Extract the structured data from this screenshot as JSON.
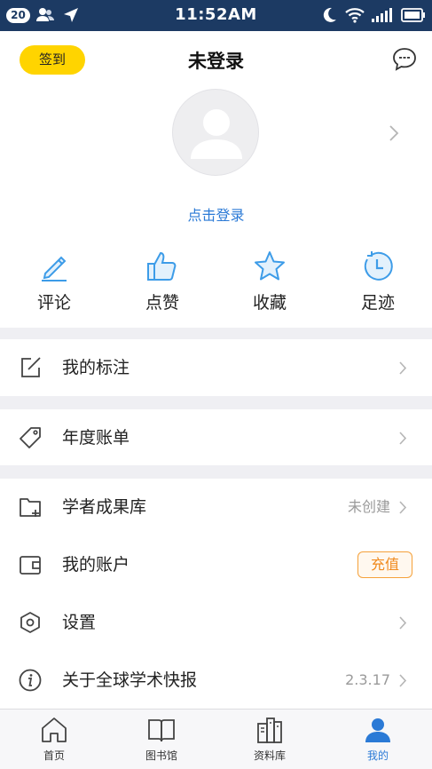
{
  "status_bar": {
    "badge": "20",
    "time": "11:52AM"
  },
  "header": {
    "checkin_label": "签到",
    "title": "未登录"
  },
  "profile": {
    "login_link": "点击登录"
  },
  "quick_actions": [
    {
      "label": "评论",
      "icon": "pencil-icon"
    },
    {
      "label": "点赞",
      "icon": "thumbs-up-icon"
    },
    {
      "label": "收藏",
      "icon": "star-icon"
    },
    {
      "label": "足迹",
      "icon": "history-clock-icon"
    }
  ],
  "menu": {
    "annotations": {
      "label": "我的标注",
      "icon": "edit-square-icon"
    },
    "annual_bill": {
      "label": "年度账单",
      "icon": "tag-icon"
    },
    "scholar_repo": {
      "label": "学者成果库",
      "value": "未创建",
      "icon": "folder-plus-icon"
    },
    "account": {
      "label": "我的账户",
      "action": "充值",
      "icon": "wallet-icon"
    },
    "settings": {
      "label": "设置",
      "icon": "hexagon-gear-icon"
    },
    "about": {
      "label": "关于全球学术快报",
      "value": "2.3.17",
      "icon": "info-icon"
    }
  },
  "tabs": [
    {
      "label": "首页",
      "icon": "home-icon"
    },
    {
      "label": "图书馆",
      "icon": "book-icon"
    },
    {
      "label": "资料库",
      "icon": "database-shelf-icon"
    },
    {
      "label": "我的",
      "icon": "person-icon",
      "active": true
    }
  ],
  "colors": {
    "status_bar": "#1c3a63",
    "accent_blue": "#2b7ad6",
    "icon_blue": "#3d9ce8",
    "checkin_yellow": "#ffd400",
    "recharge_orange": "#f08a1e",
    "separator": "#efeff3"
  }
}
